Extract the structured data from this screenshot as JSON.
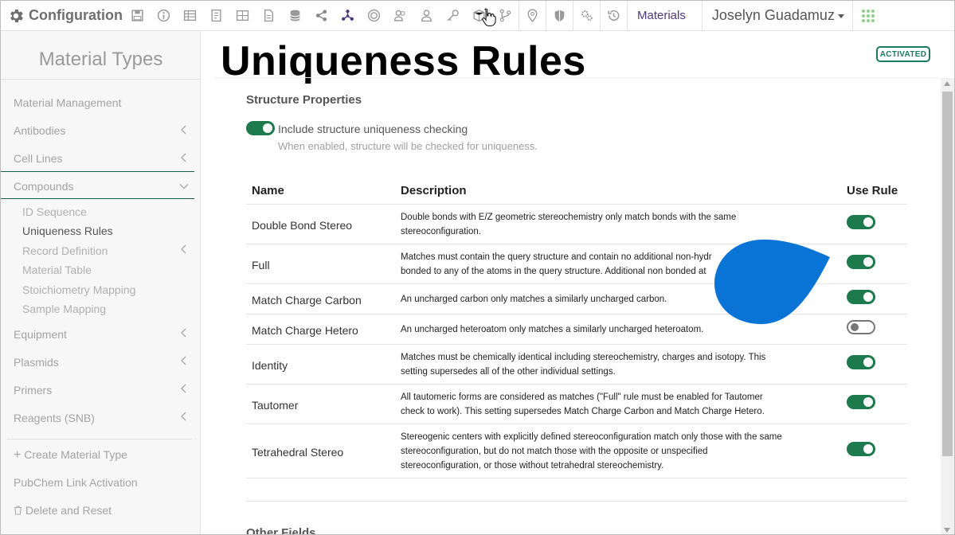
{
  "app": {
    "title": "Configuration"
  },
  "topbar": {
    "tools": [
      "save-icon",
      "info-icon",
      "table-icon",
      "notebook-icon",
      "grid-icon",
      "document-icon",
      "database-icon",
      "share-icon",
      "molecule-icon",
      "badge-icon",
      "user-group-icon",
      "user-icon",
      "key-icon",
      "package-icon",
      "branch-icon",
      "location-icon",
      "shield-icon",
      "gears-icon",
      "history-icon"
    ],
    "materials_link": "Materials",
    "user_name": "Joselyn Guadamuz"
  },
  "sidebar": {
    "title": "Material Types",
    "items": [
      {
        "label": "Material Management"
      },
      {
        "label": "Antibodies"
      },
      {
        "label": "Cell Lines"
      },
      {
        "label": "Compounds"
      }
    ],
    "compound_children": [
      {
        "label": "ID Sequence"
      },
      {
        "label": "Uniqueness Rules"
      },
      {
        "label": "Record Definition"
      },
      {
        "label": "Material Table"
      },
      {
        "label": "Stoichiometry Mapping"
      },
      {
        "label": "Sample Mapping"
      }
    ],
    "more_items": [
      {
        "label": "Equipment"
      },
      {
        "label": "Plasmids"
      },
      {
        "label": "Primers"
      },
      {
        "label": "Reagents (SNB)"
      }
    ],
    "actions": {
      "create": "Create Material Type",
      "pubchem": "PubChem Link Activation",
      "delete": "Delete and Reset"
    }
  },
  "main": {
    "title": "Uniqueness Rules",
    "status_badge": "ACTIVATED",
    "structure_section": {
      "title": "Structure Properties",
      "include_label": "Include structure uniqueness checking",
      "include_help": "When enabled, structure will be checked for uniqueness.",
      "include_enabled": true
    },
    "table": {
      "headers": {
        "name": "Name",
        "description": "Description",
        "use_rule": "Use Rule"
      },
      "rows": [
        {
          "name": "Double Bond Stereo",
          "desc1": "Double bonds with E/Z geometric stereochemistry only match bonds with the same",
          "desc2": "stereoconfiguration.",
          "desc3": "",
          "enabled": true
        },
        {
          "name": "Full",
          "desc1": "Matches must contain the query structure and contain no additional non-hydr",
          "desc2": "bonded to any of the atoms in the query structure. Additional non bonded at",
          "desc3": "",
          "enabled": true
        },
        {
          "name": "Match Charge Carbon",
          "desc1": "An uncharged carbon only matches a similarly uncharged carbon.",
          "desc2": "",
          "desc3": "",
          "enabled": true
        },
        {
          "name": "Match Charge Hetero",
          "desc1": "An uncharged heteroatom only matches a similarly uncharged heteroatom.",
          "desc2": "",
          "desc3": "",
          "enabled": false
        },
        {
          "name": "Identity",
          "desc1": "Matches must be chemically identical including stereochemistry, charges and isotopy. This",
          "desc2": "setting supersedes all of the other individual settings.",
          "desc3": "",
          "enabled": true
        },
        {
          "name": "Tautomer",
          "desc1": "All tautomeric forms are considered as matches (\"Full\" rule must be enabled for Tautomer",
          "desc2": "check to work). This setting supersedes Match Charge Carbon and Match Charge Hetero.",
          "desc3": "",
          "enabled": true
        },
        {
          "name": "Tetrahedral Stereo",
          "desc1": "Stereogenic centers with explicitly defined stereoconfiguration match only those with the same",
          "desc2": "stereoconfiguration, but do not match those with the opposite or unspecified",
          "desc3": "stereoconfiguration, or those without tetrahedral stereochemistry.",
          "enabled": true
        }
      ]
    },
    "other_fields_title": "Other Fields"
  },
  "colors": {
    "accent_green": "#1d7a4c",
    "brand_purple": "#4b3a7a",
    "overlay_blue": "#0a74d6"
  }
}
